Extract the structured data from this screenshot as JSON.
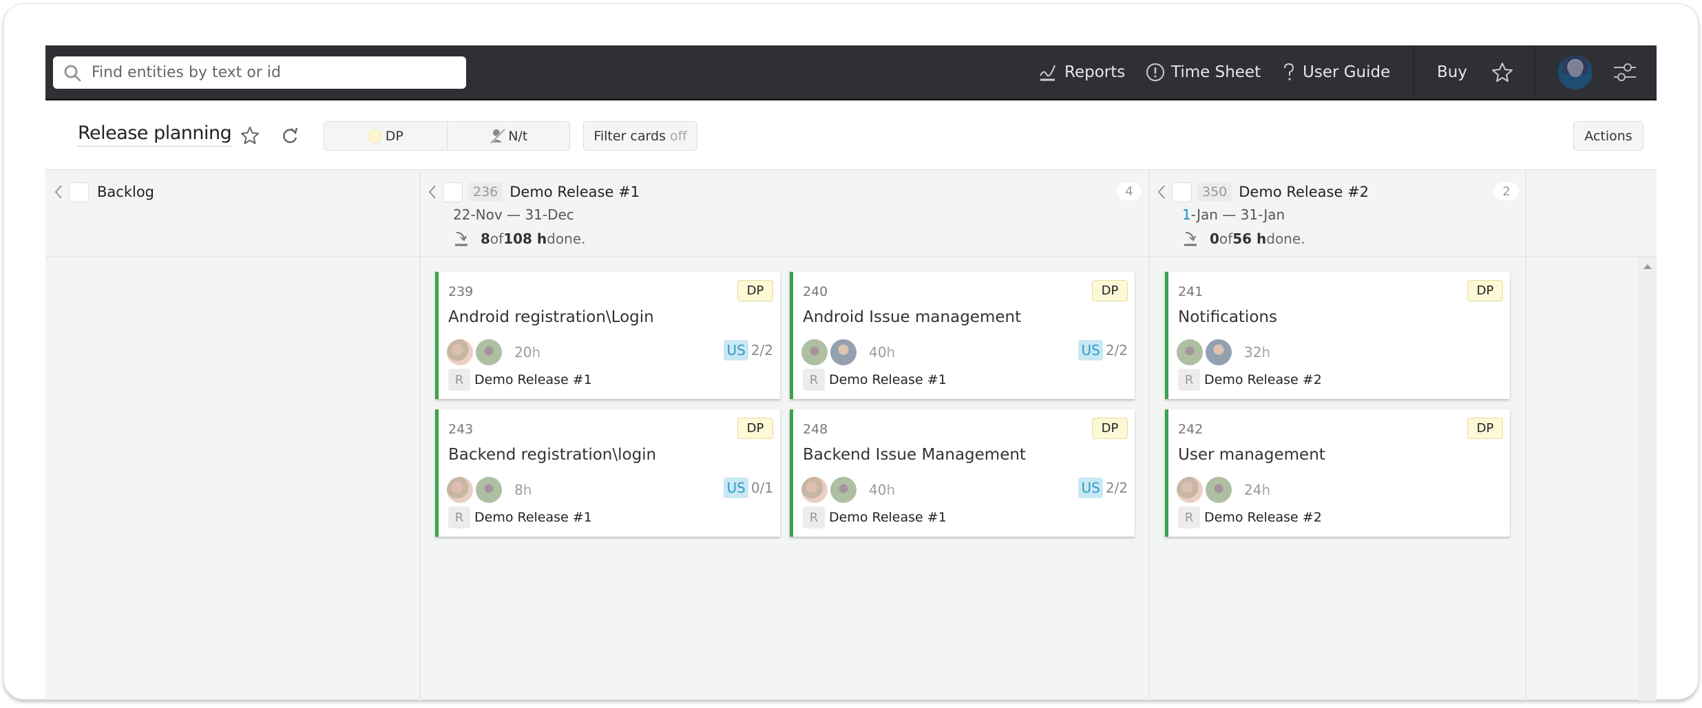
{
  "nav": {
    "search_placeholder": "Find entities by text or id",
    "links": [
      {
        "label": "Reports",
        "icon": "reports-chart-icon"
      },
      {
        "label": "Time Sheet",
        "icon": "clock-icon"
      },
      {
        "label": "User Guide",
        "icon": "question-icon"
      }
    ],
    "buy_label": "Buy"
  },
  "toolbar": {
    "title": "Release planning",
    "seg_dp_label": "DP",
    "seg_nt_label": "N/t",
    "filter_label": "Filter cards",
    "filter_state": "off",
    "actions_label": "Actions"
  },
  "board": {
    "columns": [
      {
        "name": "Backlog"
      },
      {
        "id": "236",
        "name": "Demo Release #1",
        "count": "4",
        "dates_start": "22-Nov",
        "dates_sep": " — ",
        "dates_end": "31-Dec",
        "done": "8",
        "of": " of ",
        "total": "108 h",
        "done_suffix": " done."
      },
      {
        "id": "350",
        "name": "Demo Release #2",
        "count": "2",
        "dates_start_hl": "1",
        "dates_start_rest": "-Jan",
        "dates_sep": " — ",
        "dates_end": "31-Jan",
        "done": "0",
        "of": " of ",
        "total": "56 h",
        "done_suffix": " done."
      }
    ],
    "cards": [
      {
        "id": "239",
        "tag": "DP",
        "title": "Android registration\\Login",
        "hours": "20",
        "unit": "h",
        "us_tag": "US",
        "us_count": "2/2",
        "release_tag": "R",
        "release": "Demo Release #1"
      },
      {
        "id": "240",
        "tag": "DP",
        "title": "Android Issue management",
        "hours": "40",
        "unit": "h",
        "us_tag": "US",
        "us_count": "2/2",
        "release_tag": "R",
        "release": "Demo Release #1"
      },
      {
        "id": "243",
        "tag": "DP",
        "title": "Backend registration\\login",
        "hours": "8",
        "unit": "h",
        "us_tag": "US",
        "us_count": "0/1",
        "release_tag": "R",
        "release": "Demo Release #1"
      },
      {
        "id": "248",
        "tag": "DP",
        "title": "Backend Issue Management",
        "hours": "40",
        "unit": "h",
        "us_tag": "US",
        "us_count": "2/2",
        "release_tag": "R",
        "release": "Demo Release #1"
      },
      {
        "id": "241",
        "tag": "DP",
        "title": "Notifications",
        "hours": "32",
        "unit": "h",
        "release_tag": "R",
        "release": "Demo Release #2"
      },
      {
        "id": "242",
        "tag": "DP",
        "title": "User management",
        "hours": "24",
        "unit": "h",
        "release_tag": "R",
        "release": "Demo Release #2"
      }
    ]
  },
  "colors": {
    "nav_bg": "#2f3035",
    "card_accent": "#3aa34b",
    "dp_tag_bg": "#fdf8d6",
    "us_tag_bg": "#c9e8f3",
    "us_tag_text": "#2d9cc9",
    "board_bg": "#f3f4f4"
  }
}
